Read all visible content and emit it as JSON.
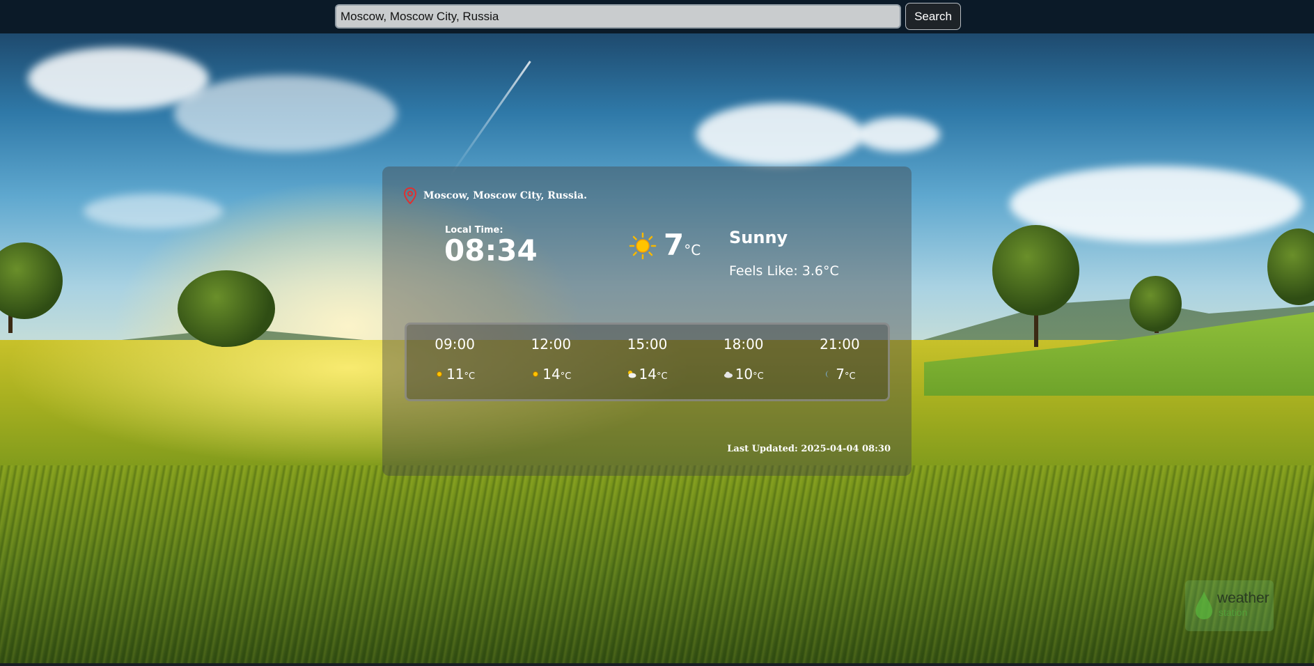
{
  "search": {
    "value": "Moscow, Moscow City, Russia",
    "placeholder": "",
    "button_label": "Search"
  },
  "card": {
    "location": "Moscow, Moscow City, Russia.",
    "local_time_label": "Local Time:",
    "local_time": "08:34",
    "current_temp": "7",
    "temp_unit": "°C",
    "condition": "Sunny",
    "feels_like": "Feels Like: 3.6°C",
    "last_updated": "Last Updated: 2025-04-04 08:30"
  },
  "forecast": [
    {
      "time": "09:00",
      "temp": "11",
      "unit": "°C",
      "icon": "sun-icon"
    },
    {
      "time": "12:00",
      "temp": "14",
      "unit": "°C",
      "icon": "sun-icon"
    },
    {
      "time": "15:00",
      "temp": "14",
      "unit": "°C",
      "icon": "partly-cloudy-icon"
    },
    {
      "time": "18:00",
      "temp": "10",
      "unit": "°C",
      "icon": "cloud-icon"
    },
    {
      "time": "21:00",
      "temp": "7",
      "unit": "°C",
      "icon": "moon-icon"
    }
  ],
  "logo": {
    "line1": "weather",
    "line2": "station"
  },
  "colors": {
    "pin": "#e03030",
    "sun": "#f6b800",
    "topbar": "#0b1a28"
  }
}
